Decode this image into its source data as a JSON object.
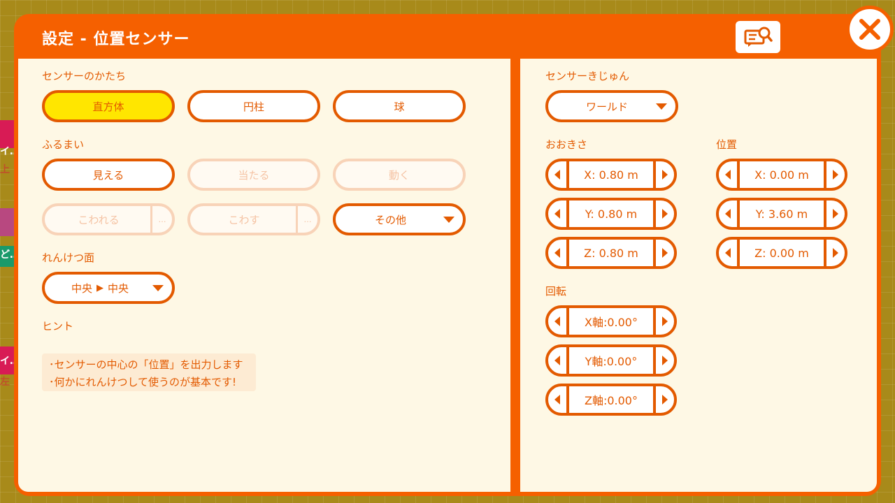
{
  "dialog": {
    "title": "設定 - 位置センサー",
    "help_icon": "search-doc-icon",
    "close_icon": "close-icon"
  },
  "background": {
    "frag_1": "イ…",
    "frag_2": "上",
    "frag_3": "ど…",
    "frag_4": "イ…",
    "frag_5": "左"
  },
  "shape": {
    "label": "センサーのかたち",
    "options": [
      "直方体",
      "円柱",
      "球"
    ],
    "selected": "直方体"
  },
  "behavior": {
    "label": "ふるまい",
    "visible": "見える",
    "hit": "当たる",
    "move": "動く",
    "break": "こわれる",
    "destroy": "こわす",
    "other": "その他",
    "more_glyph": "…"
  },
  "connection": {
    "label": "れんけつ面",
    "value_from": "中央",
    "arrow": "▶",
    "value_to": "中央"
  },
  "hint": {
    "label": "ヒント",
    "line1": "･センサーの中心の「位置」を出力します",
    "line2": "･何かにれんけつして使うのが基本です!"
  },
  "sensor_basis": {
    "label": "センサーきじゅん",
    "value": "ワールド"
  },
  "size": {
    "label": "おおきさ",
    "x": "X: 0.80 m",
    "y": "Y: 0.80 m",
    "z": "Z: 0.80 m"
  },
  "position": {
    "label": "位置",
    "x": "X: 0.00 m",
    "y": "Y: 3.60 m",
    "z": "Z: 0.00 m"
  },
  "rotation": {
    "label": "回転",
    "x": "X軸:0.00°",
    "y": "Y軸:0.00°",
    "z": "Z軸:0.00°"
  },
  "colors": {
    "accent": "#f56000",
    "panel": "#fef8e5",
    "selected": "#ffe600",
    "disabled": "#f8d3b8"
  }
}
